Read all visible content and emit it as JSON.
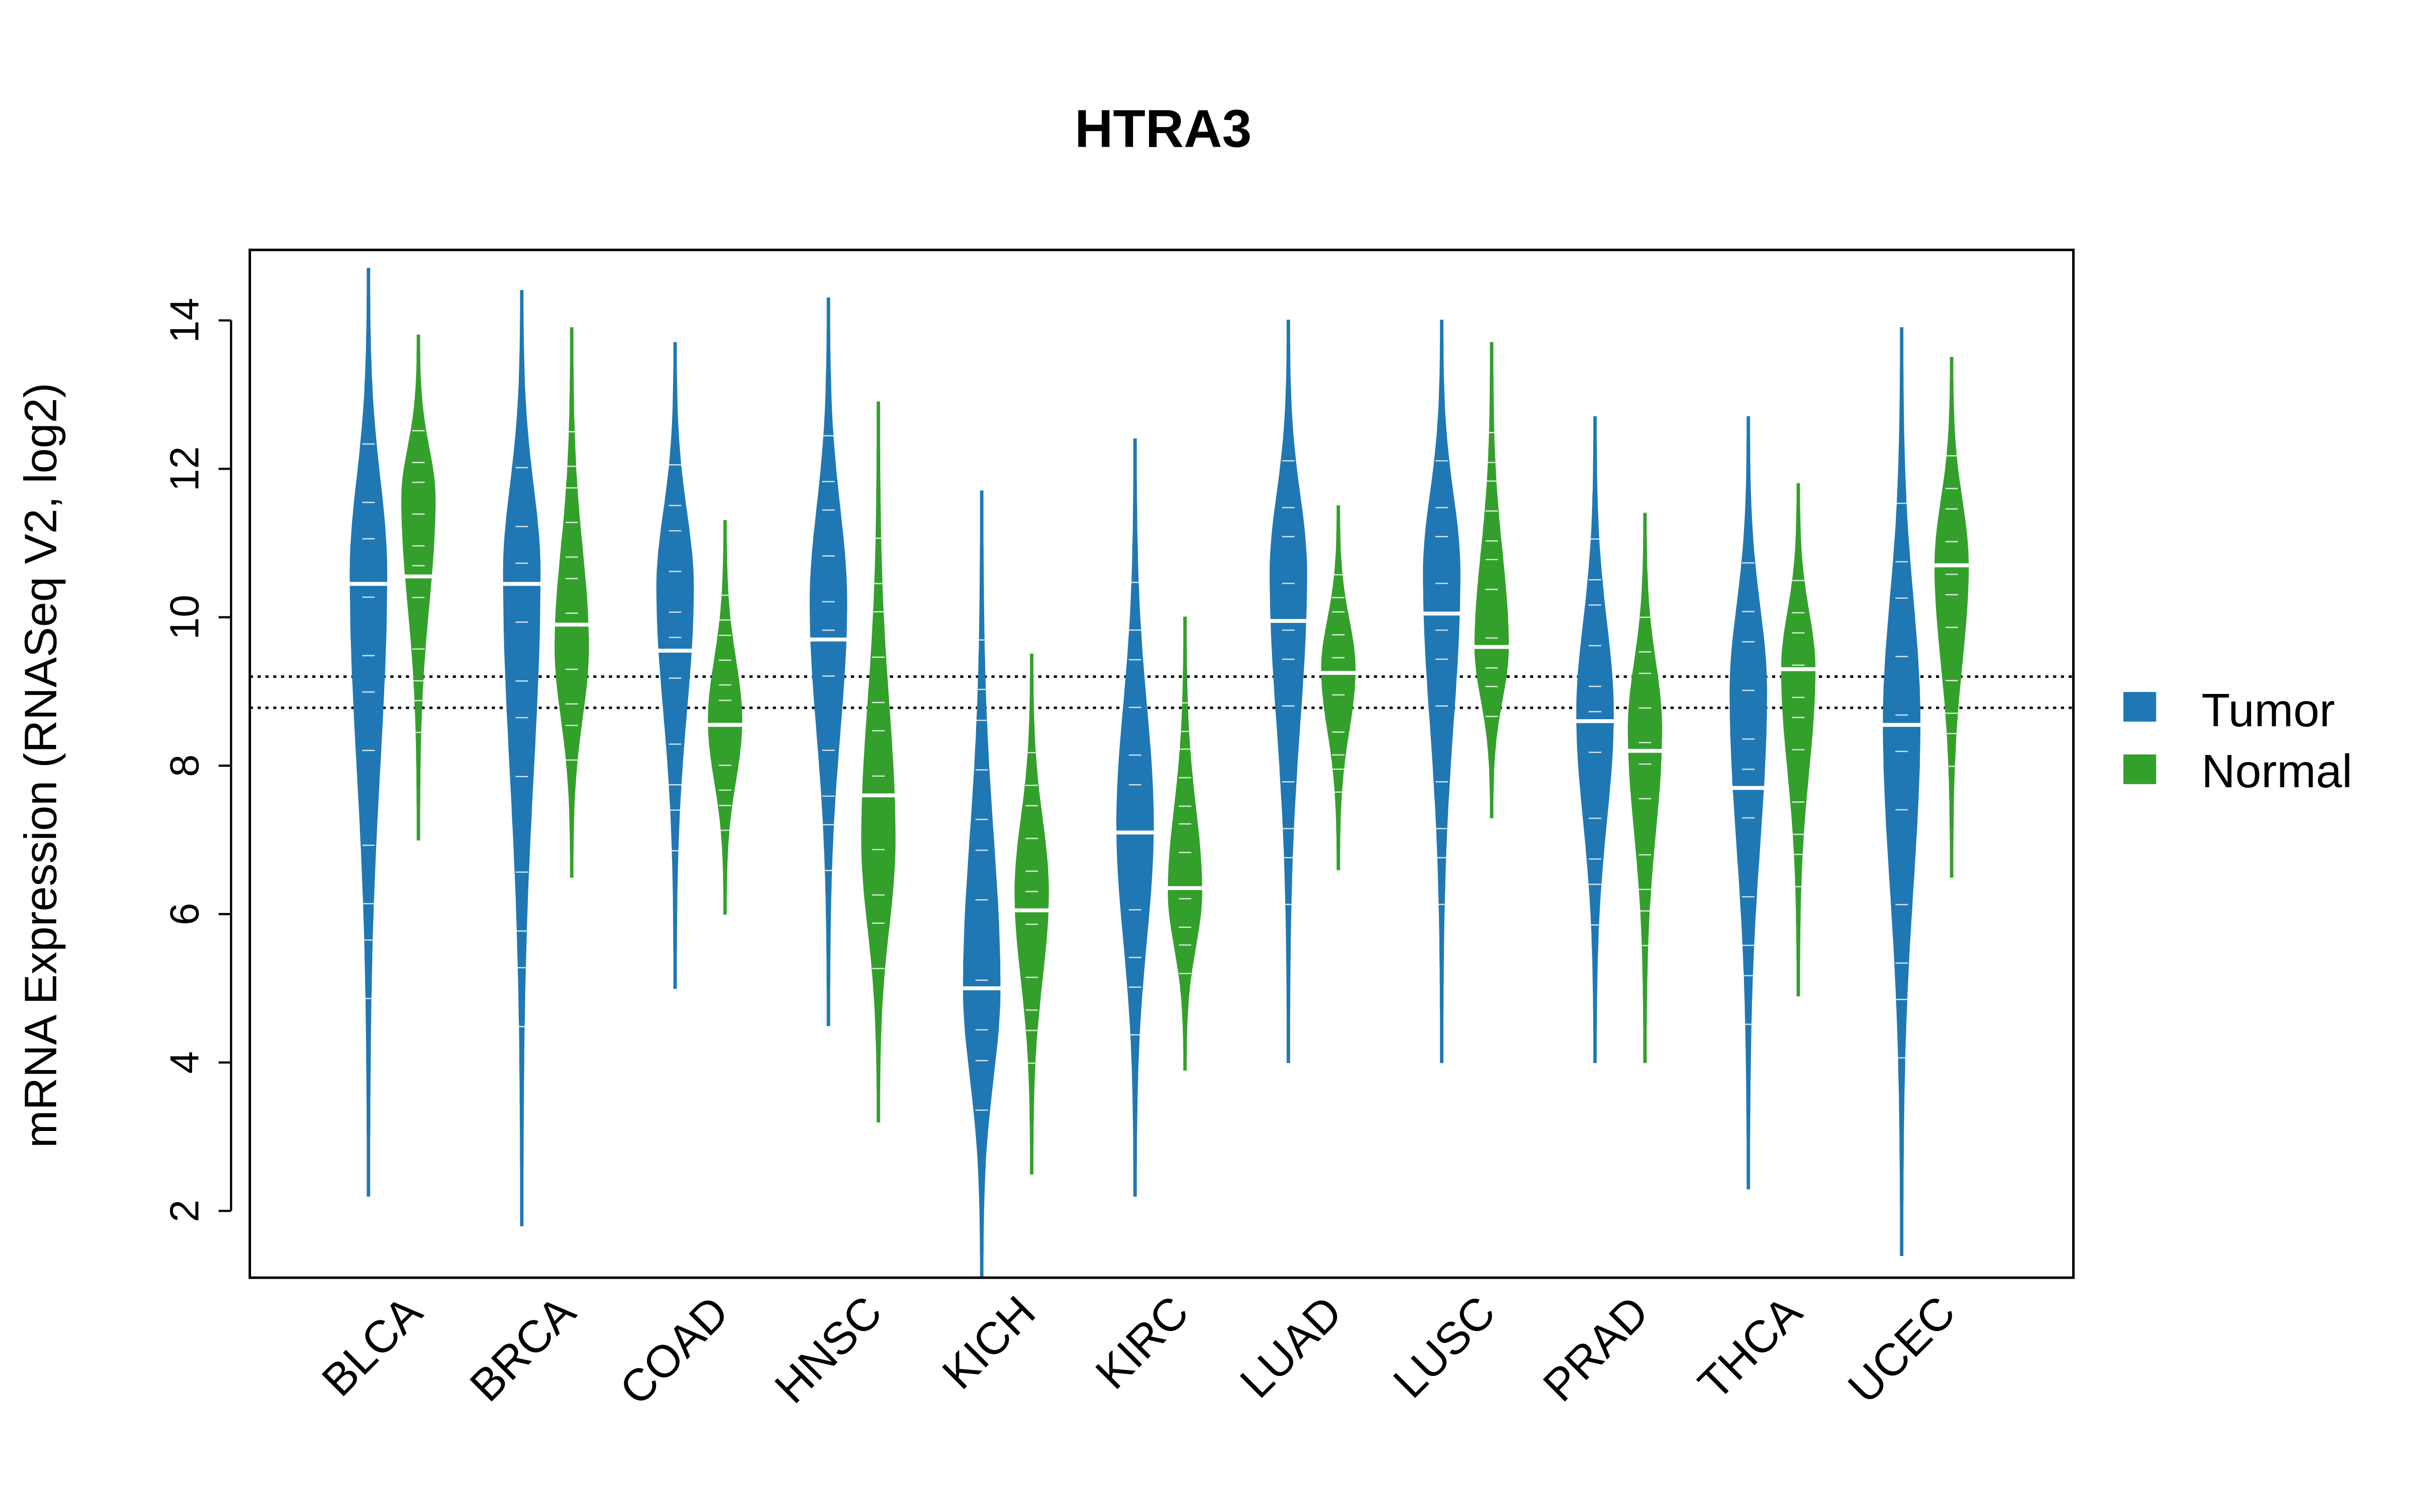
{
  "chart_data": {
    "type": "violin",
    "title": "HTRA3",
    "xlabel": "",
    "ylabel": "mRNA Expression (RNASeq V2, log2)",
    "ylim": [
      1.1,
      14.95
    ],
    "yticks": [
      2,
      4,
      6,
      8,
      10,
      12,
      14
    ],
    "grid": false,
    "legend_position": "right",
    "reference_lines": [
      9.2,
      8.78
    ],
    "colors": {
      "Tumor": "#1f78b4",
      "Normal": "#33a02c"
    },
    "series_names": [
      "Tumor",
      "Normal"
    ],
    "categories": [
      "BLCA",
      "BRCA",
      "COAD",
      "HNSC",
      "KICH",
      "KIRC",
      "LUAD",
      "LUSC",
      "PRAD",
      "THCA",
      "UCEC"
    ],
    "series": [
      {
        "name": "Tumor",
        "median": [
          10.45,
          10.45,
          9.55,
          9.7,
          5.0,
          7.1,
          9.95,
          10.05,
          8.6,
          7.7,
          8.55
        ],
        "min": [
          2.2,
          1.8,
          5.0,
          4.5,
          1.1,
          2.2,
          4.0,
          4.0,
          4.0,
          2.3,
          1.4
        ],
        "max": [
          14.7,
          14.4,
          13.7,
          14.3,
          11.7,
          12.4,
          14.0,
          14.0,
          12.7,
          12.7,
          13.9
        ],
        "mode": [
          10.6,
          10.6,
          10.4,
          10.2,
          5.0,
          7.2,
          10.6,
          10.6,
          8.7,
          9.0,
          8.6
        ]
      },
      {
        "name": "Normal",
        "median": [
          10.55,
          9.9,
          8.55,
          7.6,
          6.05,
          6.35,
          9.25,
          9.6,
          8.2,
          9.3,
          10.7
        ],
        "min": [
          7.0,
          6.5,
          6.0,
          3.2,
          2.5,
          3.9,
          6.6,
          7.3,
          4.0,
          4.9,
          6.5
        ],
        "max": [
          13.8,
          13.9,
          11.3,
          12.9,
          9.5,
          10.0,
          11.5,
          13.7,
          11.4,
          11.8,
          13.5
        ],
        "mode": [
          11.6,
          9.6,
          8.6,
          7.0,
          6.3,
          6.3,
          9.3,
          9.6,
          8.5,
          9.3,
          10.7
        ]
      }
    ]
  }
}
